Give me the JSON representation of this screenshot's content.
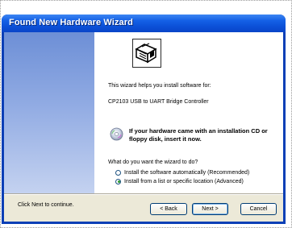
{
  "window": {
    "title": "Found New Hardware Wizard"
  },
  "content": {
    "intro": "This wizard helps you install software for:",
    "device_name": "CP2103 USB to UART Bridge Controller",
    "cd_notice": "If your hardware came with an installation CD or floppy disk, insert it now.",
    "question": "What do you want the wizard to do?",
    "options": [
      {
        "label": "Install the software automatically (Recommended)",
        "selected": false
      },
      {
        "label": "Install from a list or specific location (Advanced)",
        "selected": true
      }
    ],
    "continue_hint": "Click Next to continue."
  },
  "buttons": {
    "back": "< Back",
    "next": "Next >",
    "cancel": "Cancel"
  },
  "icons": {
    "wizard": "hardware-wizard-icon",
    "cd": "cd-disc-icon"
  }
}
